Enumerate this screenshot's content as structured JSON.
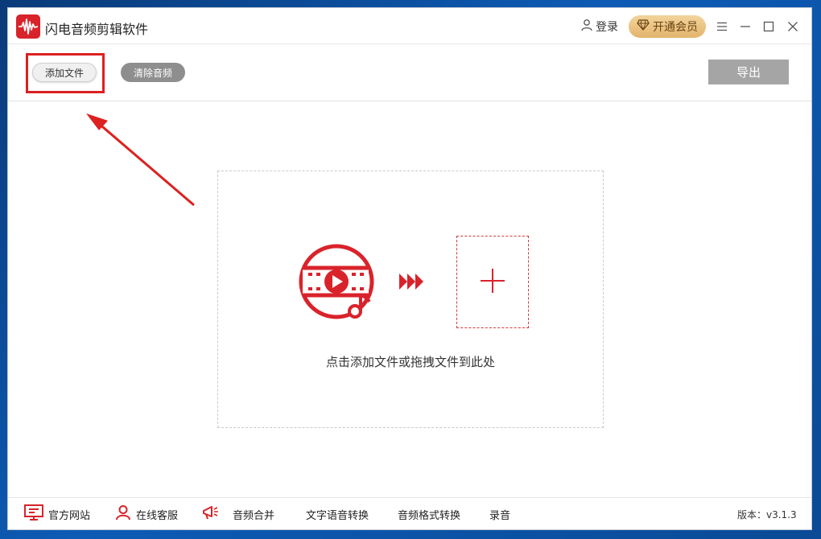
{
  "app": {
    "title": "闪电音频剪辑软件",
    "logo_icon": "audio-wave-logo-icon",
    "brand_color": "#d9232b"
  },
  "header": {
    "login_label": "登录",
    "login_icon": "user-icon",
    "vip_label": "开通会员",
    "vip_icon": "diamond-icon",
    "controls": [
      "menu-icon",
      "minimize-icon",
      "maximize-icon",
      "close-icon"
    ]
  },
  "toolbar": {
    "add_file_label": "添加文件",
    "clear_audio_label": "清除音频",
    "export_label": "导出"
  },
  "dropzone": {
    "hint": "点击添加文件或拖拽文件到此处",
    "media_icon": "video-music-icon",
    "arrows_icon": "triple-chevron-right-icon",
    "plus_icon": "plus-icon"
  },
  "footer": {
    "items": [
      {
        "label": "官方网站",
        "icon": "monitor-icon"
      },
      {
        "label": "在线客服",
        "icon": "user-icon"
      },
      {
        "label": "音频合并",
        "icon": "megaphone-icon"
      },
      {
        "label": "文字语音转换"
      },
      {
        "label": "音频格式转换"
      },
      {
        "label": "录音"
      }
    ],
    "version": "版本：v3.1.3"
  },
  "colors": {
    "accent_red": "#d9232b",
    "vip_gold": "#e3b46c",
    "export_gray": "#a5a5a5"
  }
}
